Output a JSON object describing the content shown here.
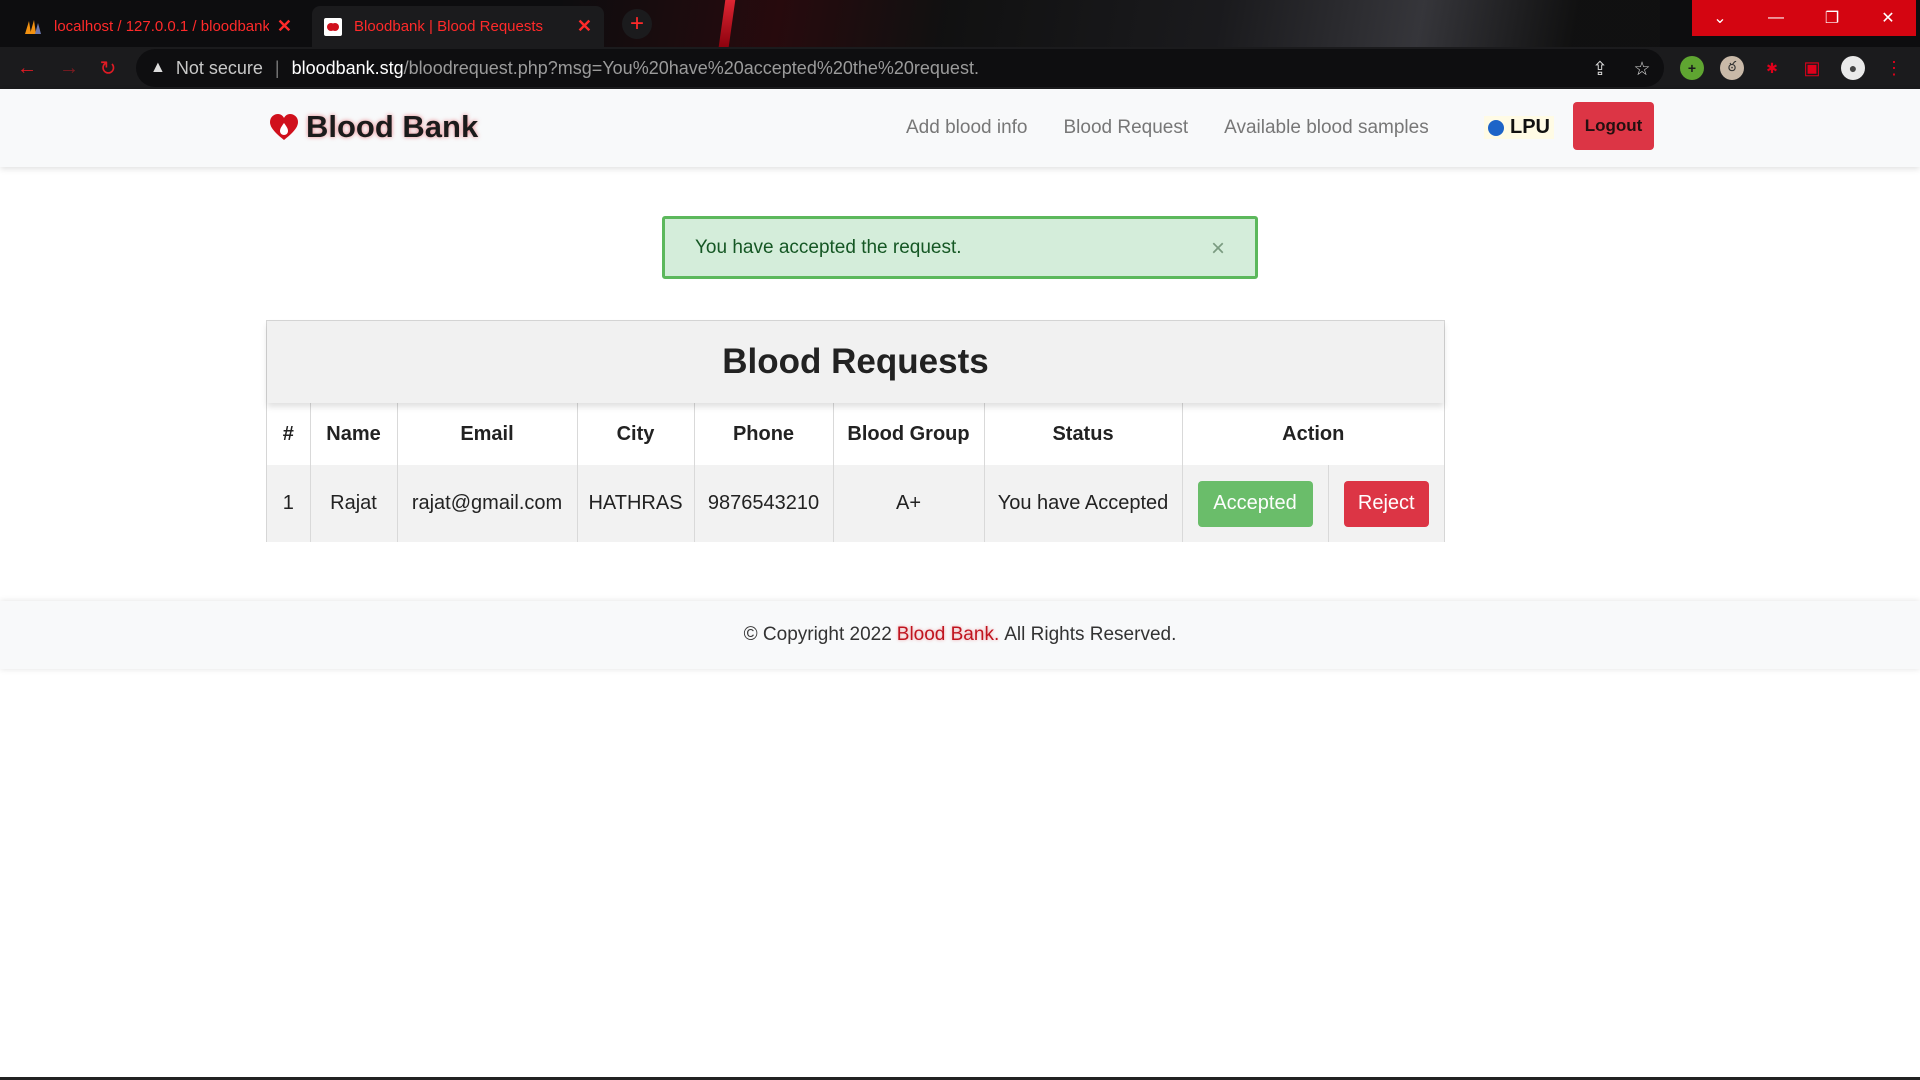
{
  "browser": {
    "tabs": [
      {
        "title": "localhost / 127.0.0.1 / bloodbank",
        "active": false
      },
      {
        "title": "Bloodbank | Blood Requests",
        "active": true
      }
    ],
    "security_label": "Not secure",
    "url_host": "bloodbank.stg",
    "url_path": "/bloodrequest.php?msg=You%20have%20accepted%20the%20request."
  },
  "nav": {
    "brand": "Blood Bank",
    "links": [
      "Add blood info",
      "Blood Request",
      "Available blood samples"
    ],
    "user": "LPU",
    "logout_label": "Logout"
  },
  "alert": {
    "message": "You have accepted the request.",
    "close_symbol": "×"
  },
  "table": {
    "title": "Blood Requests",
    "headers": [
      "#",
      "Name",
      "Email",
      "City",
      "Phone",
      "Blood Group",
      "Status",
      "Action"
    ],
    "rows": [
      {
        "num": "1",
        "name": "Rajat",
        "email": "rajat@gmail.com",
        "city": "HATHRAS",
        "phone": "9876543210",
        "blood_group": "A+",
        "status": "You have Accepted",
        "accepted_label": "Accepted",
        "reject_label": "Reject"
      }
    ]
  },
  "footer": {
    "prefix": "© Copyright 2022",
    "brand": "Blood Bank.",
    "suffix": "All Rights Reserved."
  },
  "colors": {
    "brand_red": "#dc3545",
    "success_green": "#5cb85c",
    "chrome_accent": "#ff2a2a"
  }
}
